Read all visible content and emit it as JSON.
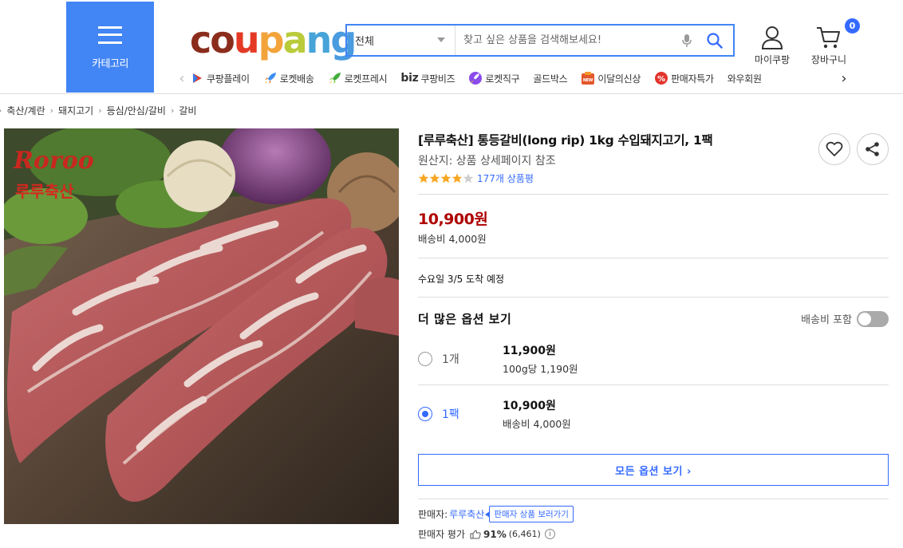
{
  "header": {
    "category_label": "카테고리",
    "logo": {
      "letters": [
        "c",
        "o",
        "u",
        "p",
        "a",
        "n",
        "g"
      ],
      "colors": [
        "#8b2d1c",
        "#8b2d1c",
        "#e43a25",
        "#f2a43b",
        "#b9cb3a",
        "#47a4d9",
        "#4a9bdf"
      ]
    },
    "search": {
      "category": "전체",
      "placeholder": "찾고 싶은 상품을 검색해보세요!"
    },
    "my_coupang": "마이쿠팡",
    "cart": {
      "label": "장바구니",
      "count": "0"
    },
    "quick_nav": [
      {
        "label": "쿠팡플레이",
        "icon": "coupang-play-icon"
      },
      {
        "label": "로켓배송",
        "icon": "rocket-icon"
      },
      {
        "label": "로켓프레시",
        "icon": "rocket-fresh-icon"
      },
      {
        "label": "쿠팡비즈",
        "prefix": "biz",
        "icon": "biz-icon"
      },
      {
        "label": "로켓직구",
        "icon": "rocket-global-icon"
      },
      {
        "label": "골드박스",
        "icon": ""
      },
      {
        "label": "이달의신상",
        "icon": "new-badge-icon"
      },
      {
        "label": "판매자특가",
        "icon": "percent-icon"
      },
      {
        "label": "와우회원",
        "icon": ""
      }
    ]
  },
  "breadcrumb": [
    "축산/계란",
    "돼지고기",
    "등심/안심/갈비",
    "갈비"
  ],
  "product": {
    "image_logo_text": "루루축산",
    "image_logo_script": "Roroo",
    "title": "[루루축산] 통등갈비(long rip) 1kg 수입돼지고기, 1팩",
    "origin": "원산지: 상품 상세페이지 참조",
    "rating_stars": 4,
    "review_count": "177개 상품평",
    "price": "10,900원",
    "shipping_fee": "배송비 4,000원",
    "delivery": "수요일 3/5 도착 예정",
    "options_title": "더 많은 옵션 보기",
    "shipping_toggle_label": "배송비 포함",
    "options": [
      {
        "name": "1개",
        "price": "11,900원",
        "sub": "100g당 1,190원",
        "selected": false
      },
      {
        "name": "1팩",
        "price": "10,900원",
        "sub": "배송비 4,000원",
        "selected": true
      }
    ],
    "all_options_label": "모든 옵션 보기 ›",
    "seller_label": "판매자:",
    "seller_name": "루루축산",
    "seller_tip": "판매자 상품 보러가기",
    "seller_rating_label": "판매자 평가",
    "seller_rating_value": "91%",
    "seller_rating_count": "(6,461)"
  }
}
